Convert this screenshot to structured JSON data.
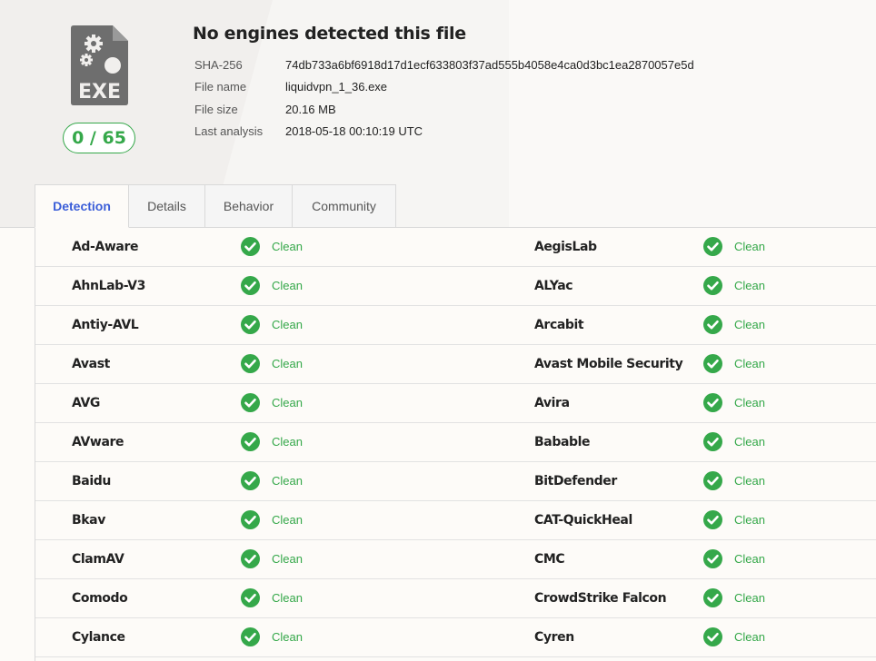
{
  "file": {
    "icon_label": "EXE",
    "score": "0 / 65",
    "title": "No engines detected this file",
    "meta": [
      {
        "label": "SHA-256",
        "value": "74db733a6bf6918d17d1ecf633803f37ad555b4058e4ca0d3bc1ea2870057e5d"
      },
      {
        "label": "File name",
        "value": "liquidvpn_1_36.exe"
      },
      {
        "label": "File size",
        "value": "20.16 MB"
      },
      {
        "label": "Last analysis",
        "value": "2018-05-18 00:10:19 UTC"
      }
    ]
  },
  "tabs": [
    {
      "label": "Detection",
      "active": true
    },
    {
      "label": "Details",
      "active": false
    },
    {
      "label": "Behavior",
      "active": false
    },
    {
      "label": "Community",
      "active": false
    }
  ],
  "colors": {
    "clean": "#35a84a",
    "active_tab": "#3b5ed8",
    "icon_gray": "#6e6e6e"
  },
  "results": [
    {
      "left": {
        "engine": "Ad-Aware",
        "result": "Clean"
      },
      "right": {
        "engine": "AegisLab",
        "result": "Clean"
      }
    },
    {
      "left": {
        "engine": "AhnLab-V3",
        "result": "Clean"
      },
      "right": {
        "engine": "ALYac",
        "result": "Clean"
      }
    },
    {
      "left": {
        "engine": "Antiy-AVL",
        "result": "Clean"
      },
      "right": {
        "engine": "Arcabit",
        "result": "Clean"
      }
    },
    {
      "left": {
        "engine": "Avast",
        "result": "Clean"
      },
      "right": {
        "engine": "Avast Mobile Security",
        "result": "Clean"
      }
    },
    {
      "left": {
        "engine": "AVG",
        "result": "Clean"
      },
      "right": {
        "engine": "Avira",
        "result": "Clean"
      }
    },
    {
      "left": {
        "engine": "AVware",
        "result": "Clean"
      },
      "right": {
        "engine": "Babable",
        "result": "Clean"
      }
    },
    {
      "left": {
        "engine": "Baidu",
        "result": "Clean"
      },
      "right": {
        "engine": "BitDefender",
        "result": "Clean"
      }
    },
    {
      "left": {
        "engine": "Bkav",
        "result": "Clean"
      },
      "right": {
        "engine": "CAT-QuickHeal",
        "result": "Clean"
      }
    },
    {
      "left": {
        "engine": "ClamAV",
        "result": "Clean"
      },
      "right": {
        "engine": "CMC",
        "result": "Clean"
      }
    },
    {
      "left": {
        "engine": "Comodo",
        "result": "Clean"
      },
      "right": {
        "engine": "CrowdStrike Falcon",
        "result": "Clean"
      }
    },
    {
      "left": {
        "engine": "Cylance",
        "result": "Clean"
      },
      "right": {
        "engine": "Cyren",
        "result": "Clean"
      }
    }
  ]
}
